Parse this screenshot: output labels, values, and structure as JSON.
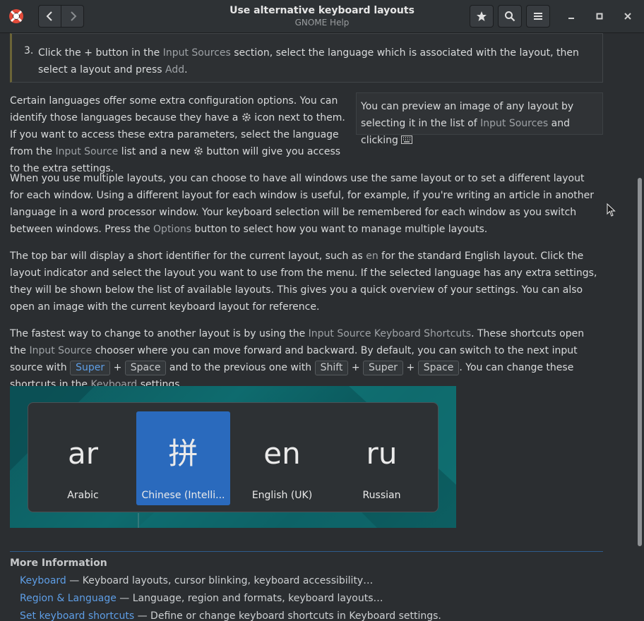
{
  "header": {
    "title": "Use alternative keyboard layouts",
    "subtitle": "GNOME Help"
  },
  "icons": {
    "app": "help-lifebuoy-icon",
    "back": "chevron-left-icon",
    "forward": "chevron-right-icon",
    "bookmark": "star-icon",
    "search": "search-icon",
    "menu": "hamburger-icon",
    "minimize": "minimize-icon",
    "maximize": "maximize-icon",
    "close": "close-icon",
    "config": "gear-icon",
    "keyboard": "keyboard-icon"
  },
  "step3": {
    "num": "3.",
    "t1": "Click the",
    "plus": "+",
    "t2": "button in the",
    "l1": "Input Sources",
    "t3": "section, select the language which is associated with the layout, then select a layout and press",
    "l2": "Add",
    "t4": "."
  },
  "para1": {
    "t1": "Certain languages offer some extra configuration options. You can identify those languages because they have a",
    "t2": "icon next to them. If you want to access these extra parameters, select the language from the",
    "l1": "Input Source",
    "t3": "list and a new",
    "t4": "button will give you access to the extra settings."
  },
  "aside": {
    "t1": "You can preview an image of any layout by selecting it in the list of",
    "l1": "Input Sources",
    "t2": "and clicking"
  },
  "para2": {
    "t1": "When you use multiple layouts, you can choose to have all windows use the same layout or to set a different layout for each window. Using a different layout for each window is useful, for example, if you're writing an article in another language in a word processor window. Your keyboard selection will be remembered for each window as you switch between windows. Press the",
    "l1": "Options",
    "t2": "button to select how you want to manage multiple layouts."
  },
  "para3": {
    "t1": "The top bar will display a short identifier for the current layout, such as",
    "l1": "en",
    "t2": "for the standard English layout. Click the layout indicator and select the layout you want to use from the menu. If the selected language has any extra settings, they will be shown below the list of available layouts. This gives you a quick overview of your settings. You can also open an image with the current keyboard layout for reference."
  },
  "para4": {
    "t1": "The fastest way to change to another layout is by using the",
    "l1": "Input Source Keyboard Shortcuts",
    "t2": ". These shortcuts open the",
    "l2": "Input Source",
    "t3": "chooser where you can move forward and backward. By default, you can switch to the next input source with",
    "k1": "Super",
    "plus": "+",
    "k2": "Space",
    "t4": "and to the previous one with",
    "k3": "Shift",
    "k4": "Super",
    "k5": "Space",
    "t5": ". You can change these shortcuts in the",
    "l3": "Keyboard",
    "t6": "settings."
  },
  "switcher": {
    "items": [
      {
        "glyph": "ar",
        "label": "Arabic"
      },
      {
        "glyph": "拼",
        "label": "Chinese (Intelli..."
      },
      {
        "glyph": "en",
        "label": "English (UK)"
      },
      {
        "glyph": "ru",
        "label": "Russian"
      }
    ],
    "selected_index": 1
  },
  "more_info": {
    "heading": "More Information",
    "links": [
      {
        "link": "Keyboard",
        "desc": "— Keyboard layouts, cursor blinking, keyboard accessibility…"
      },
      {
        "link": "Region & Language",
        "desc": "— Language, region and formats, keyboard layouts…"
      },
      {
        "link": "Set keyboard shortcuts",
        "desc": "— Define or change keyboard shortcuts in Keyboard settings."
      }
    ]
  },
  "colors": {
    "link_blue": "#5e9ee6",
    "selection": "#2a6abd",
    "background": "#2b2e31"
  }
}
